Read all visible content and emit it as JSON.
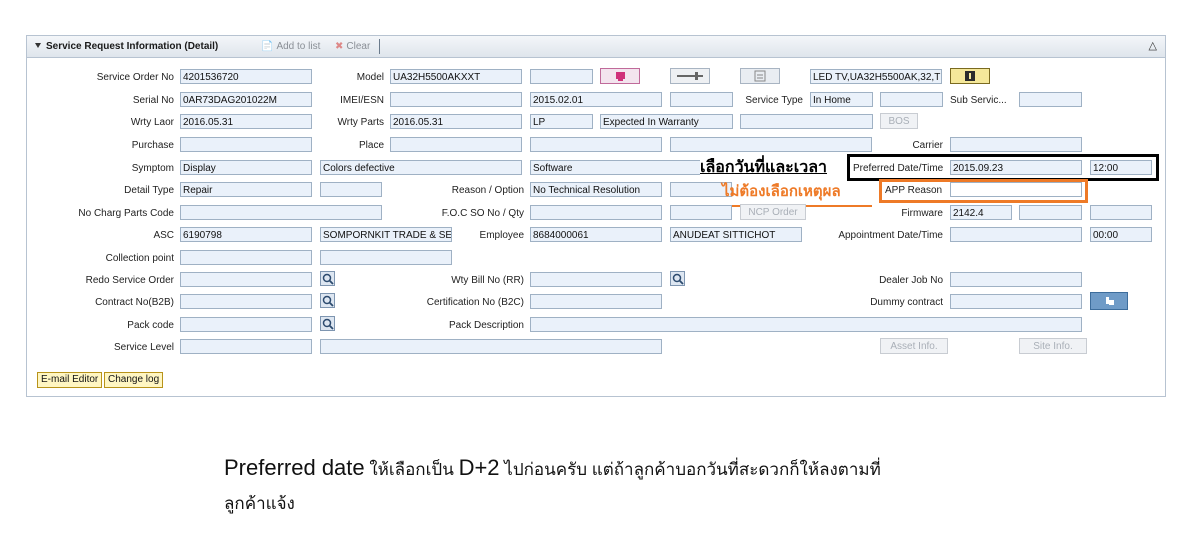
{
  "panel": {
    "title": "Service Request Information (Detail)",
    "add_to_list": "Add to list",
    "clear": "Clear"
  },
  "labels": {
    "service_order_no": "Service Order No",
    "model": "Model",
    "serial_no": "Serial No",
    "imei_esn": "IMEI/ESN",
    "service_type": "Service Type",
    "sub_service": "Sub Servic...",
    "wrty_laor": "Wrty Laor",
    "wrty_parts": "Wrty Parts",
    "purchase": "Purchase",
    "place": "Place",
    "carrier": "Carrier",
    "symptom": "Symptom",
    "preferred_date_time": "Preferred Date/Time",
    "detail_type": "Detail Type",
    "reason_option": "Reason / Option",
    "app_reason": "APP Reason",
    "no_charg_parts_code": "No Charg Parts Code",
    "foc_so_no_qty": "F.O.C SO No / Qty",
    "firmware": "Firmware",
    "asc": "ASC",
    "employee": "Employee",
    "appointment_date_time": "Appointment Date/Time",
    "collection_point": "Collection point",
    "redo_service_order": "Redo Service Order",
    "wty_bill_no": "Wty Bill No (RR)",
    "dealer_job_no": "Dealer Job No",
    "contract_no_b2b": "Contract No(B2B)",
    "certification_no_b2c": "Certification No (B2C)",
    "dummy_contract": "Dummy contract",
    "pack_code": "Pack code",
    "pack_description": "Pack Description",
    "service_level": "Service Level"
  },
  "values": {
    "service_order_no": "4201536720",
    "model": "UA32H5500AKXXT",
    "model_desc": "LED TV,UA32H5500AK,32,T",
    "serial_no": "0AR73DAG201022M",
    "date_2015_02_01": "2015.02.01",
    "service_type": "In Home",
    "wrty_laor": "2016.05.31",
    "wrty_parts": "2016.05.31",
    "lp": "LP",
    "warranty_status": "Expected In Warranty",
    "symptom_1": "Display",
    "symptom_2": "Colors defective",
    "symptom_3": "Software",
    "preferred_date": "2015.09.23",
    "preferred_time": "12:00",
    "detail_type": "Repair",
    "reason_option": "No Technical Resolution",
    "firmware": "2142.4",
    "asc": "6190798",
    "asc_name": "SOMPORNKIT TRADE & SER",
    "employee_id": "8684000061",
    "employee_name": "ANUDEAT SITTICHOT",
    "appointment_time": "00:00"
  },
  "buttons": {
    "bos": "BOS",
    "ncp_order": "NCP Order",
    "asset_info": "Asset Info.",
    "site_info": "Site Info.",
    "email_editor": "E-mail Editor",
    "change_log": "Change log"
  },
  "annotations": {
    "select_date_time": "เลือกวันที่และเวลา",
    "no_reason_needed": "ไม่ต้องเลือกเหตุผล",
    "caption_en": "Preferred date",
    "caption_th1": " ให้เลือกเป็น ",
    "caption_d2": "D+2",
    "caption_th2": " ไปก่อนครับ แต่ถ้าลูกค้าบอกวันที่สะดวกก็ให้ลงตามที่",
    "caption_th3": "ลูกค้าแจ้ง"
  },
  "colors": {
    "field_bg": "#eaf1fa",
    "field_border": "#9fb1c4",
    "annotation_orange": "#ee7a27",
    "annotation_black": "#000000"
  }
}
